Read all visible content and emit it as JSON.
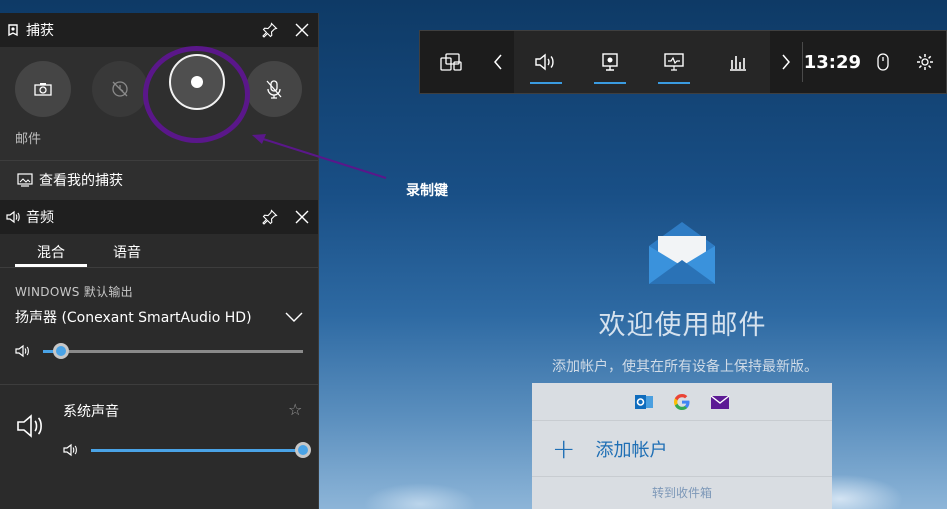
{
  "capture_panel": {
    "title": "捕获",
    "caption": "邮件",
    "view_captures": "查看我的捕获"
  },
  "audio_panel": {
    "title": "音频",
    "tabs": [
      "混合",
      "语音"
    ],
    "section_label": "WINDOWS 默认输出",
    "device": "扬声器 (Conexant SmartAudio HD)",
    "master_volume": 0.07,
    "app_name": "系统声音",
    "app_volume": 1.0
  },
  "gamebar": {
    "time": "13:29"
  },
  "annotation": {
    "label": "录制键"
  },
  "mail": {
    "title": "欢迎使用邮件",
    "subtitle": "添加帐户，使其在所有设备上保持最新版。",
    "add_account": "添加帐户",
    "goto_inbox": "转到收件箱"
  },
  "colors": {
    "accent": "#3a9be0",
    "annotation": "#5a178a",
    "mail_link": "#1f6fb5"
  }
}
